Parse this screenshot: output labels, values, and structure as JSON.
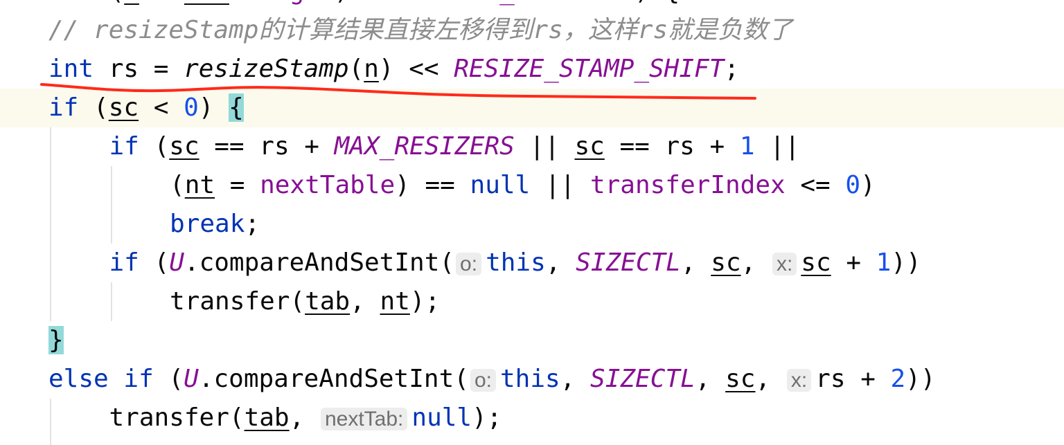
{
  "editor": {
    "annotation_color": "#ff2a1a",
    "lines": [
      {
        "indent": 1,
        "tokens": [
          {
            "t": "(",
            "c": ""
          },
          {
            "t": "n",
            "c": "ul"
          },
          {
            "t": " = ",
            "c": ""
          },
          {
            "t": "tab",
            "c": "ul"
          },
          {
            "t": ".",
            "c": ""
          },
          {
            "t": "length",
            "c": "fld"
          },
          {
            "t": ") < ",
            "c": ""
          },
          {
            "t": "MAXIMUM_CAPACITY",
            "c": "sfld"
          },
          {
            "t": ") {",
            "c": ""
          }
        ]
      },
      {
        "indent": 0,
        "tokens": [
          {
            "t": "// resizeStamp的计算结果直接左移得到rs，这样rs就是负数了",
            "c": "cmt"
          }
        ]
      },
      {
        "indent": 0,
        "tokens": [
          {
            "t": "int",
            "c": "kw"
          },
          {
            "t": " rs = ",
            "c": ""
          },
          {
            "t": "resizeStamp",
            "c": "ital"
          },
          {
            "t": "(",
            "c": ""
          },
          {
            "t": "n",
            "c": "ul"
          },
          {
            "t": ") << ",
            "c": ""
          },
          {
            "t": "RESIZE_STAMP_SHIFT",
            "c": "sfld"
          },
          {
            "t": ";",
            "c": ""
          }
        ]
      },
      {
        "indent": 0,
        "current": true,
        "tokens": [
          {
            "t": "if",
            "c": "kw"
          },
          {
            "t": " (",
            "c": ""
          },
          {
            "t": "sc",
            "c": "ul"
          },
          {
            "t": " < ",
            "c": ""
          },
          {
            "t": "0",
            "c": "num"
          },
          {
            "t": ") ",
            "c": ""
          },
          {
            "t": "{",
            "c": "brace"
          }
        ]
      },
      {
        "indent": 1,
        "tokens": [
          {
            "t": "if",
            "c": "kw"
          },
          {
            "t": " (",
            "c": ""
          },
          {
            "t": "sc",
            "c": "ul"
          },
          {
            "t": " == rs + ",
            "c": ""
          },
          {
            "t": "MAX_RESIZERS",
            "c": "sfld"
          },
          {
            "t": " || ",
            "c": ""
          },
          {
            "t": "sc",
            "c": "ul"
          },
          {
            "t": " == rs + ",
            "c": ""
          },
          {
            "t": "1",
            "c": "num"
          },
          {
            "t": " ||",
            "c": ""
          }
        ]
      },
      {
        "indent": 2,
        "tokens": [
          {
            "t": "(",
            "c": ""
          },
          {
            "t": "nt",
            "c": "ul"
          },
          {
            "t": " = ",
            "c": ""
          },
          {
            "t": "nextTable",
            "c": "fld"
          },
          {
            "t": ") == ",
            "c": ""
          },
          {
            "t": "null",
            "c": "kw"
          },
          {
            "t": " || ",
            "c": ""
          },
          {
            "t": "transferIndex",
            "c": "fld"
          },
          {
            "t": " <= ",
            "c": ""
          },
          {
            "t": "0",
            "c": "num"
          },
          {
            "t": ")",
            "c": ""
          }
        ]
      },
      {
        "indent": 2,
        "tokens": [
          {
            "t": "break",
            "c": "kw"
          },
          {
            "t": ";",
            "c": ""
          }
        ]
      },
      {
        "indent": 1,
        "tokens": [
          {
            "t": "if",
            "c": "kw"
          },
          {
            "t": " (",
            "c": ""
          },
          {
            "t": "U",
            "c": "sfld"
          },
          {
            "t": ".compareAndSetInt(",
            "c": ""
          },
          {
            "t": "o:",
            "c": "hint"
          },
          {
            "t": "this",
            "c": "kw"
          },
          {
            "t": ", ",
            "c": ""
          },
          {
            "t": "SIZECTL",
            "c": "sfld"
          },
          {
            "t": ", ",
            "c": ""
          },
          {
            "t": "sc",
            "c": "ul"
          },
          {
            "t": ", ",
            "c": ""
          },
          {
            "t": "x:",
            "c": "hint"
          },
          {
            "t": "sc",
            "c": "ul"
          },
          {
            "t": " + ",
            "c": ""
          },
          {
            "t": "1",
            "c": "num"
          },
          {
            "t": "))",
            "c": ""
          }
        ]
      },
      {
        "indent": 2,
        "tokens": [
          {
            "t": "transfer(",
            "c": ""
          },
          {
            "t": "tab",
            "c": "ul"
          },
          {
            "t": ", ",
            "c": ""
          },
          {
            "t": "nt",
            "c": "ul"
          },
          {
            "t": ");",
            "c": ""
          }
        ]
      },
      {
        "indent": 0,
        "tokens": [
          {
            "t": "}",
            "c": "brace"
          }
        ]
      },
      {
        "indent": 0,
        "tokens": [
          {
            "t": "else",
            "c": "kw"
          },
          {
            "t": " ",
            "c": ""
          },
          {
            "t": "if",
            "c": "kw"
          },
          {
            "t": " (",
            "c": ""
          },
          {
            "t": "U",
            "c": "sfld"
          },
          {
            "t": ".compareAndSetInt(",
            "c": ""
          },
          {
            "t": "o:",
            "c": "hint"
          },
          {
            "t": "this",
            "c": "kw"
          },
          {
            "t": ", ",
            "c": ""
          },
          {
            "t": "SIZECTL",
            "c": "sfld"
          },
          {
            "t": ", ",
            "c": ""
          },
          {
            "t": "sc",
            "c": "ul"
          },
          {
            "t": ", ",
            "c": ""
          },
          {
            "t": "x:",
            "c": "hint"
          },
          {
            "t": "rs + ",
            "c": ""
          },
          {
            "t": "2",
            "c": "num"
          },
          {
            "t": "))",
            "c": ""
          }
        ]
      },
      {
        "indent": 1,
        "tokens": [
          {
            "t": "transfer(",
            "c": ""
          },
          {
            "t": "tab",
            "c": "ul"
          },
          {
            "t": ", ",
            "c": ""
          },
          {
            "t": "nextTab:",
            "c": "hint"
          },
          {
            "t": "null",
            "c": "kw"
          },
          {
            "t": ");",
            "c": ""
          }
        ]
      }
    ]
  }
}
